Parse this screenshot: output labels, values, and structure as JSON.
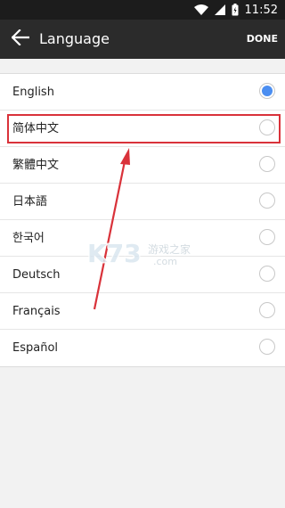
{
  "status_bar": {
    "time": "11:52",
    "icons": [
      "wifi-icon",
      "signal-icon",
      "battery-icon"
    ]
  },
  "app_bar": {
    "back_icon": "arrow-back-icon",
    "title": "Language",
    "done_label": "DONE"
  },
  "languages": [
    {
      "label": "English",
      "selected": true
    },
    {
      "label": "简体中文",
      "selected": false
    },
    {
      "label": "繁體中文",
      "selected": false
    },
    {
      "label": "日本語",
      "selected": false
    },
    {
      "label": "한국어",
      "selected": false
    },
    {
      "label": "Deutsch",
      "selected": false
    },
    {
      "label": "Français",
      "selected": false
    },
    {
      "label": "Español",
      "selected": false
    }
  ],
  "annotation": {
    "highlight_color": "#d9323a",
    "arrow_color": "#d9323a"
  },
  "colors": {
    "accent": "#4b8ef1",
    "app_bar": "#2b2b2b",
    "status_bar": "#1c1c1c",
    "background": "#f2f2f2"
  },
  "watermark": {
    "brand": "K73",
    "tagline": "游戏之家",
    "domain": ".com"
  }
}
